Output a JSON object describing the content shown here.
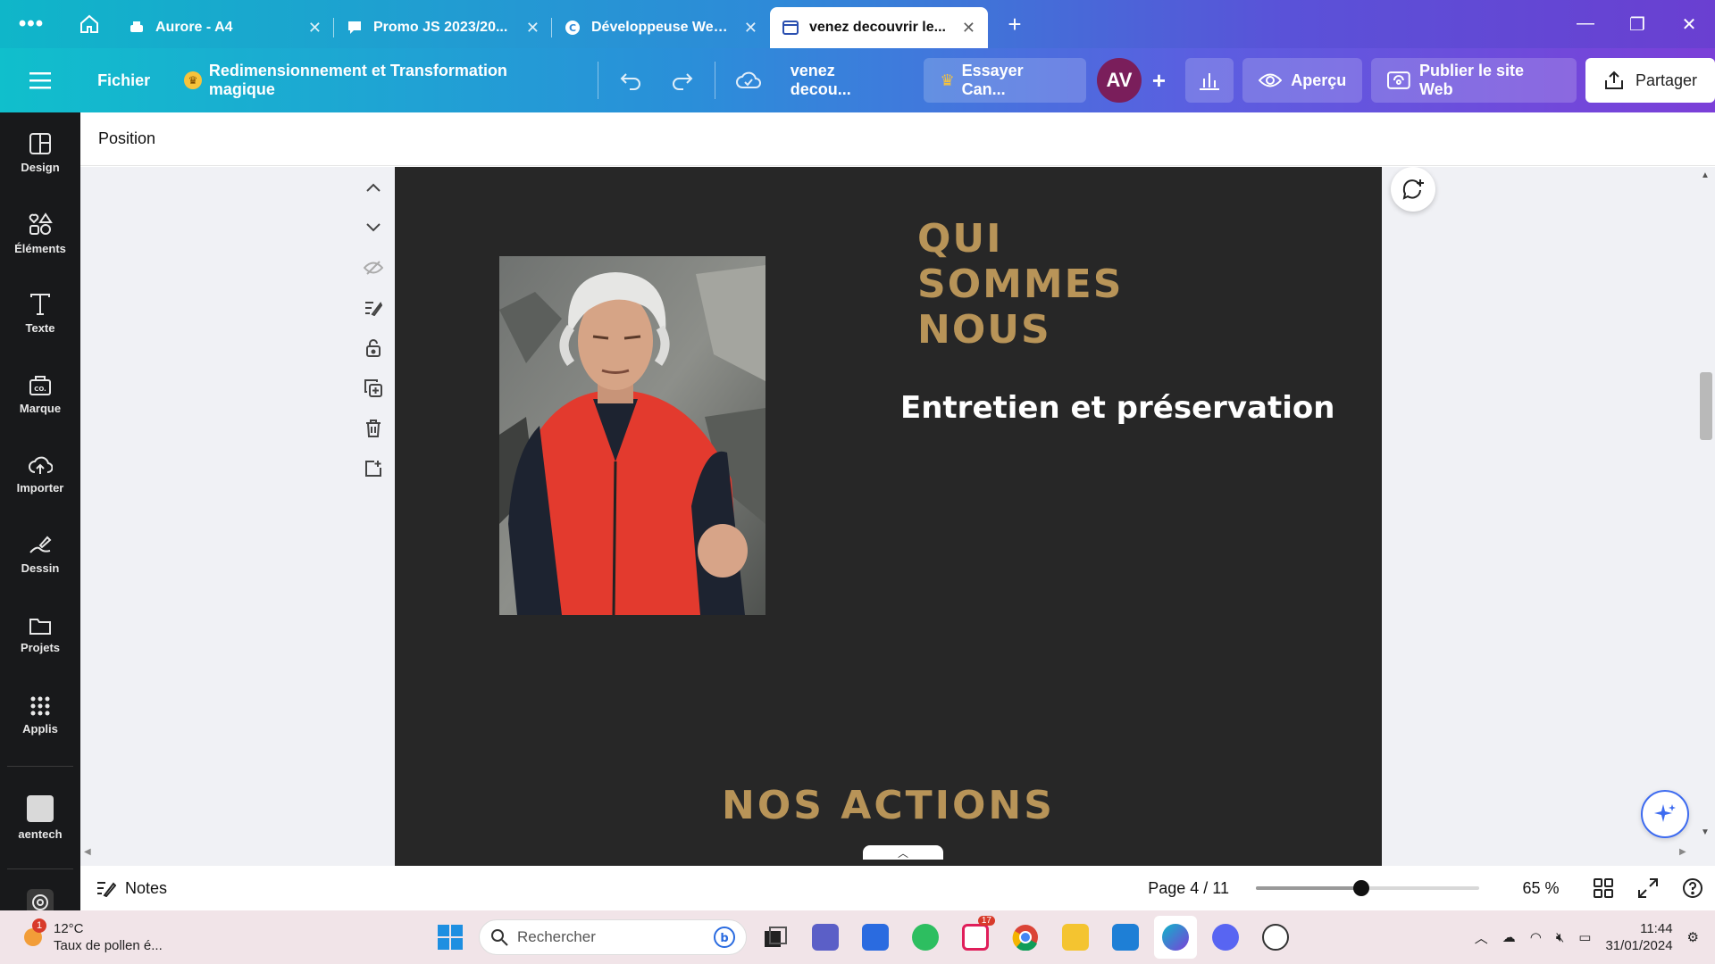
{
  "browser": {
    "tabs": [
      {
        "label": "Aurore - A4",
        "active": false
      },
      {
        "label": "Promo JS 2023/20...",
        "active": false
      },
      {
        "label": "Développeuse Web...",
        "active": false
      },
      {
        "label": "venez decouvrir le...",
        "active": true
      }
    ]
  },
  "toolbar": {
    "file_label": "Fichier",
    "magic_label": "Redimensionnement et Transformation magique",
    "doc_title": "venez decou...",
    "try_label": "Essayer Can...",
    "avatar_initials": "AV",
    "preview_label": "Aperçu",
    "publish_label": "Publier le site Web",
    "share_label": "Partager"
  },
  "rail": {
    "items": [
      {
        "label": "Design",
        "icon": "layout-icon"
      },
      {
        "label": "Éléments",
        "icon": "shapes-icon"
      },
      {
        "label": "Texte",
        "icon": "text-icon"
      },
      {
        "label": "Marque",
        "icon": "brand-icon"
      },
      {
        "label": "Importer",
        "icon": "upload-cloud-icon"
      },
      {
        "label": "Dessin",
        "icon": "draw-icon"
      },
      {
        "label": "Projets",
        "icon": "folder-icon"
      },
      {
        "label": "Applis",
        "icon": "apps-grid-icon"
      }
    ],
    "app_label": "aentech"
  },
  "header": {
    "position_label": "Position"
  },
  "canvas": {
    "heading": [
      "QUI",
      "SOMMES",
      "NOUS"
    ],
    "subheading": "Entretien et préservation",
    "actions_heading": "NOS ACTIONS",
    "background": "#272727",
    "accent": "#b89458"
  },
  "bottombar": {
    "notes_label": "Notes",
    "page_indicator": "Page 4 / 11",
    "zoom_value": "65 %",
    "zoom_fraction": 0.47
  },
  "taskbar": {
    "weather_temp": "12°C",
    "weather_desc": "Taux de pollen é...",
    "weather_badge": "1",
    "search_placeholder": "Rechercher",
    "slack_badge": "17",
    "time": "11:44",
    "date": "31/01/2024"
  }
}
